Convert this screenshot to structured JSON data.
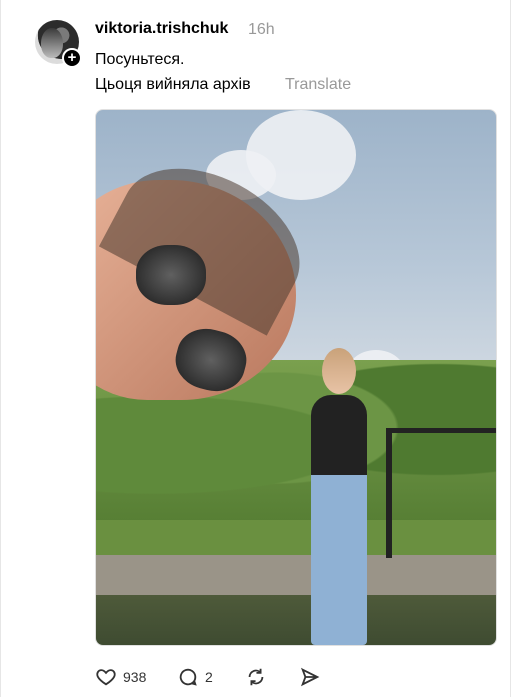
{
  "post": {
    "username": "viktoria.trishchuk",
    "time": "16h",
    "text_line1": "Посуньтеся.",
    "text_line2": "Цьоця вийняла архів",
    "translate_label": "Translate"
  },
  "actions": {
    "likes": "938",
    "replies": "2"
  },
  "icons": {
    "like": "heart-icon",
    "reply": "comment-icon",
    "repost": "repost-icon",
    "share": "send-icon",
    "follow": "plus-icon"
  },
  "colors": {
    "muted_text": "#999999",
    "primary_text": "#000000"
  }
}
